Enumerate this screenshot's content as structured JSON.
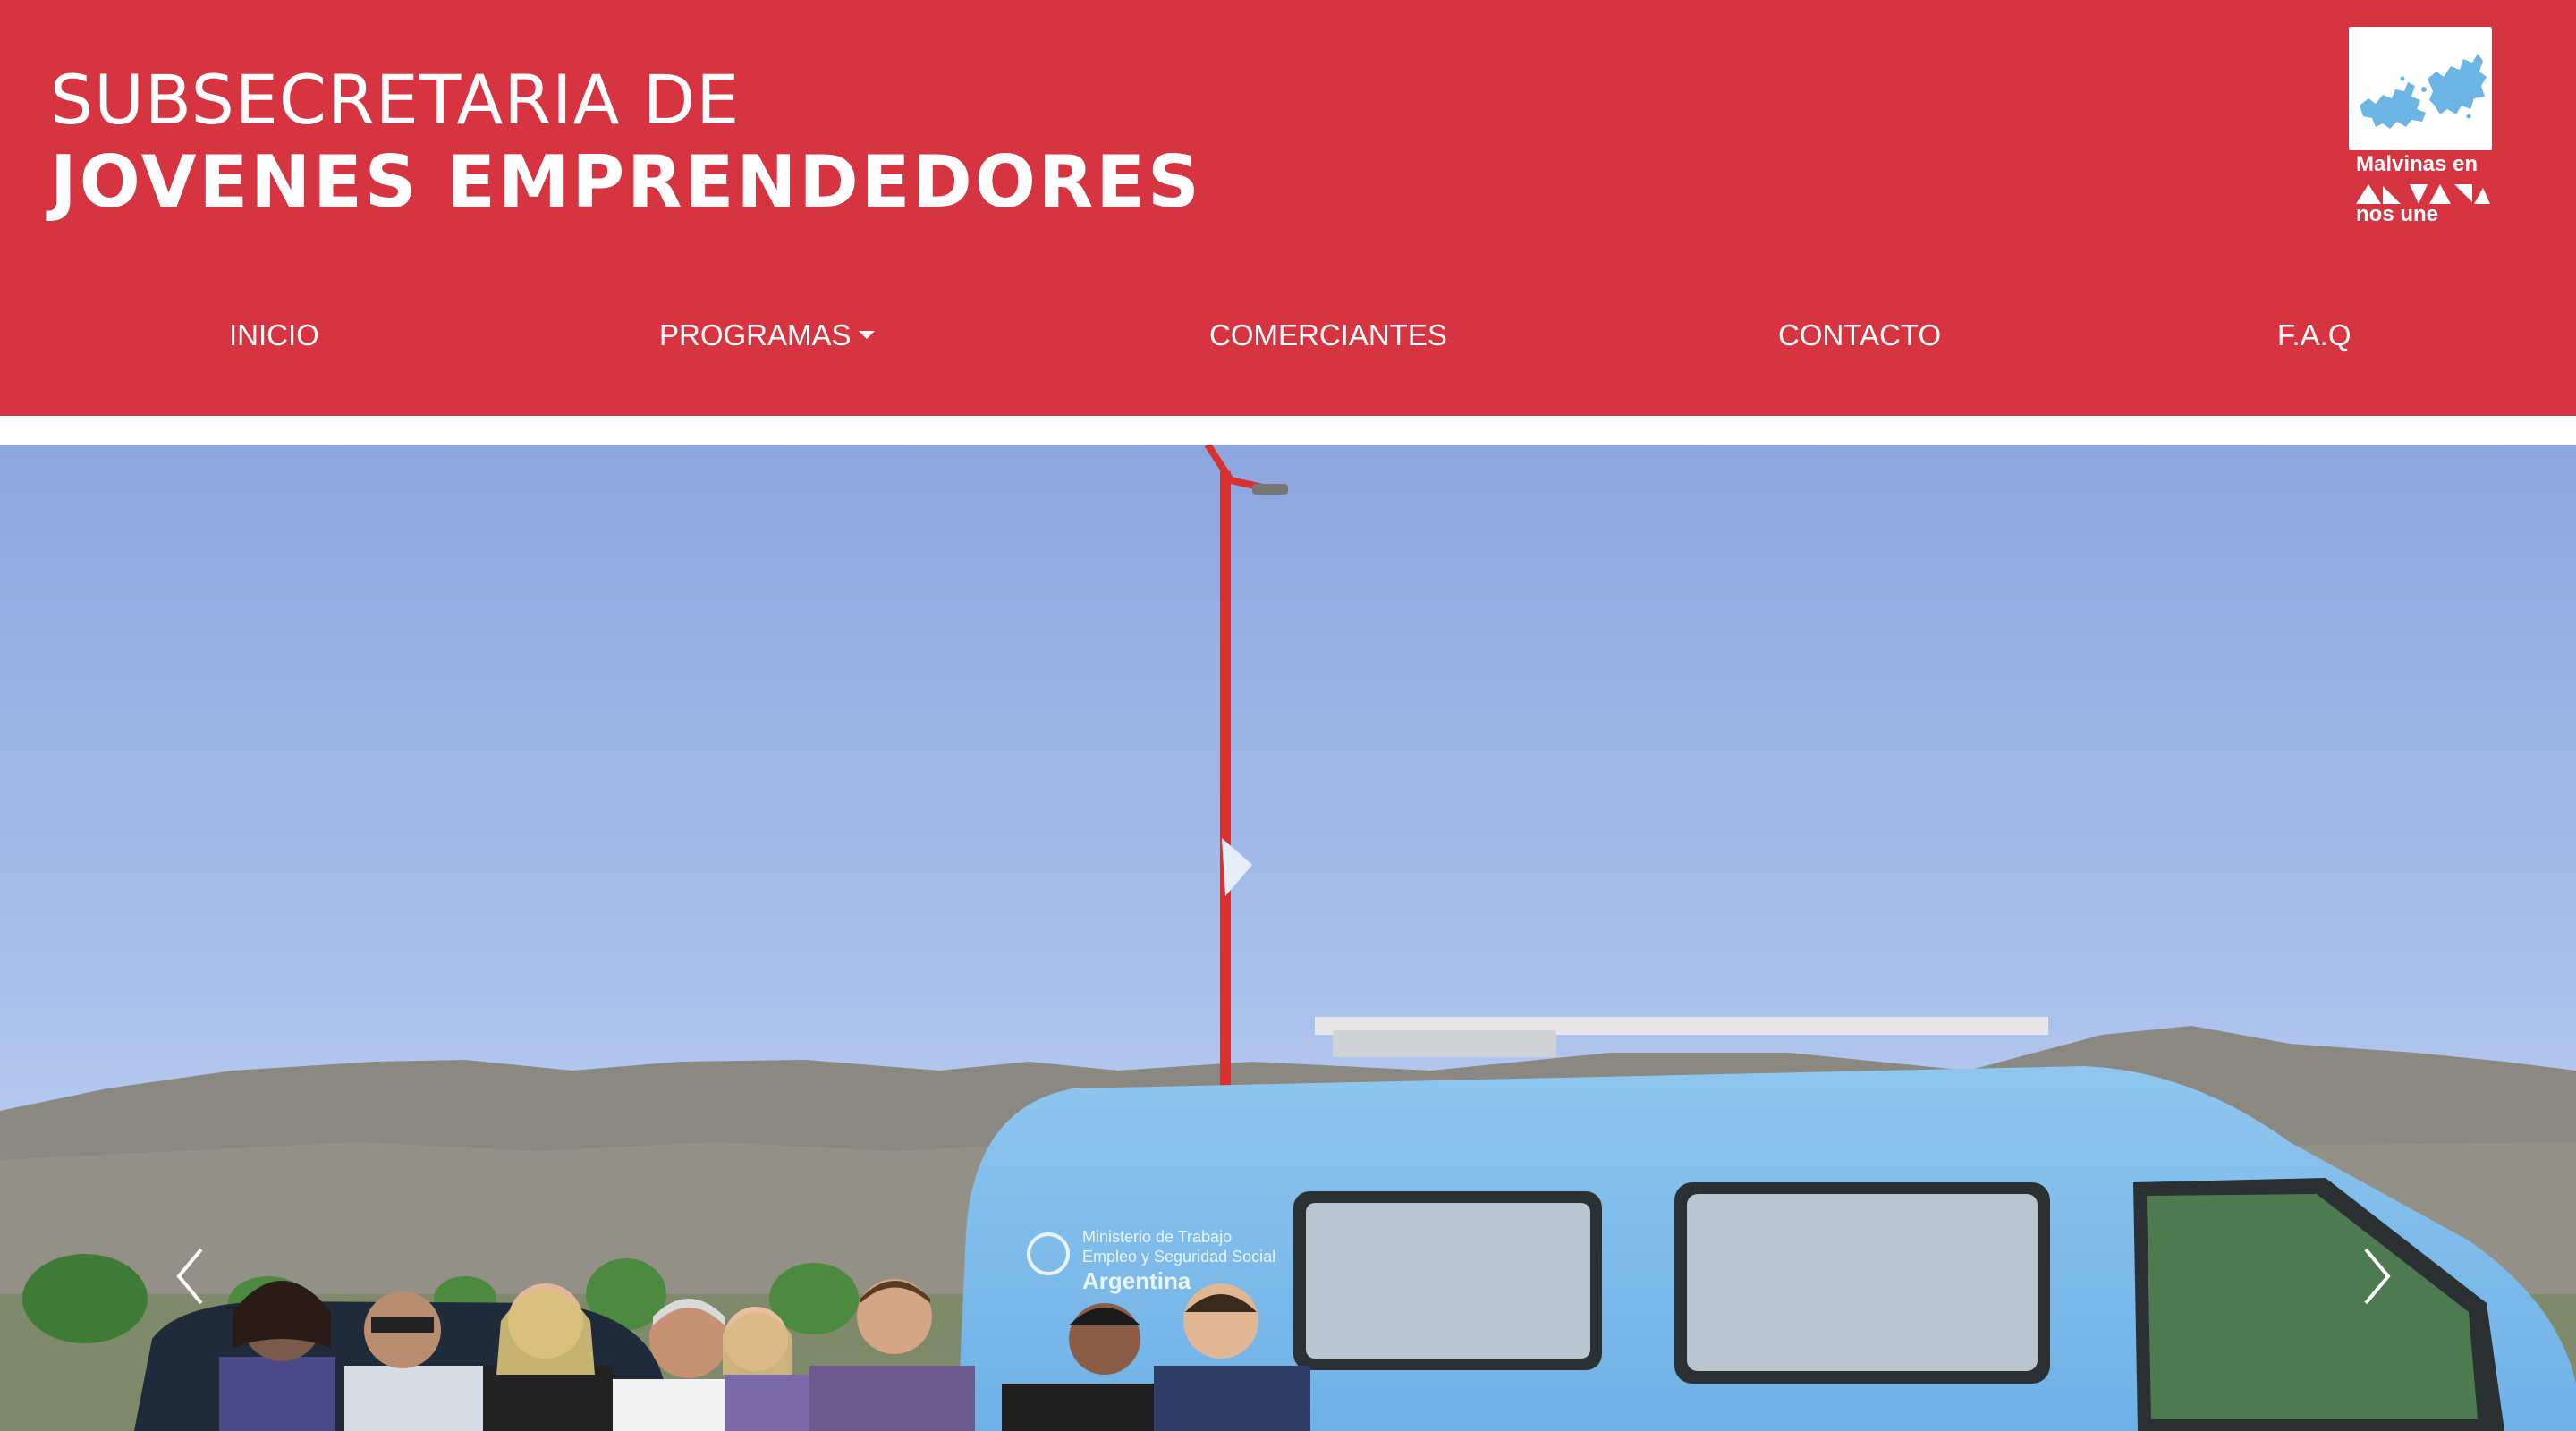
{
  "header": {
    "title_line1": "SUBSECRETARIA DE",
    "title_line2": "JOVENES EMPRENDEDORES",
    "background_color": "#d63440"
  },
  "logo": {
    "line1": "Malvinas en",
    "line2": "nos une",
    "icon": "malvinas-islands-map-icon"
  },
  "nav": {
    "items": [
      {
        "label": "INICIO"
      },
      {
        "label": "PROGRAMAS",
        "has_dropdown": true
      },
      {
        "label": "COMERCIANTES"
      },
      {
        "label": "CONTACTO"
      },
      {
        "label": "F.A.Q"
      }
    ]
  },
  "carousel": {
    "image": "group-photo-ministerio-van",
    "van_text": [
      "Ministerio de Trabajo",
      "Empleo y Seguridad Social",
      "Argentina"
    ],
    "prev_icon": "chevron-left-icon",
    "next_icon": "chevron-right-icon"
  }
}
